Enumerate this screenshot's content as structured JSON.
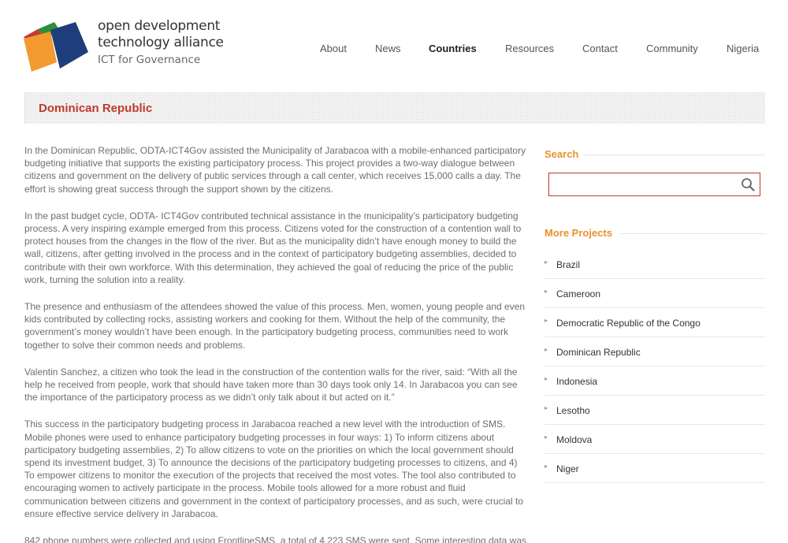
{
  "logo": {
    "line1": "open development",
    "line2": "technology alliance",
    "line3": "ICT for Governance",
    "colors": {
      "red": "#c43a2c",
      "green": "#2e8f3a",
      "orange": "#f29a2e",
      "blue": "#1e3e7b"
    }
  },
  "nav": {
    "items": [
      {
        "label": "About"
      },
      {
        "label": "News"
      },
      {
        "label": "Countries",
        "active": true
      },
      {
        "label": "Resources"
      },
      {
        "label": "Contact"
      },
      {
        "label": "Community"
      },
      {
        "label": "Nigeria"
      }
    ]
  },
  "page": {
    "title": "Dominican Republic"
  },
  "content": {
    "paragraphs": [
      "In the Dominican Republic, ODTA-ICT4Gov assisted the Municipality of Jarabacoa with a mobile-enhanced participatory budgeting initiative that supports the existing participatory process. This project provides a two-way dialogue between citizens and government on the delivery of public services through a call center, which receives 15,000 calls a day. The effort is showing great success through the support shown by the citizens.",
      "In the past budget cycle, ODTA- ICT4Gov contributed technical assistance in the municipality’s participatory budgeting process. A very inspiring example emerged from this process. Citizens voted for the construction of a contention wall to protect houses from the changes in the flow of the river. But as the municipality didn’t have enough money to build the wall, citizens, after getting involved in the process and in the context of participatory budgeting assemblies, decided to contribute with their own workforce. With this determination, they achieved the goal of reducing the price of the public work, turning the solution into a reality.",
      "The presence and enthusiasm of the attendees showed the value of this process. Men, women, young people and even kids contributed by collecting rocks, assisting workers and cooking for them. Without the help of the community, the government’s money wouldn’t have been enough. In the participatory budgeting process, communities need to work together to solve their common needs and problems.",
      "Valentin Sanchez, a citizen who took the lead in the construction of the contention walls for the river, said: “With all the help he received from people, work that should have taken more than 30 days took only 14. In Jarabacoa you can see the importance of the participatory process as we didn’t only talk about it but acted on it.”",
      "This success in the participatory budgeting process in Jarabacoa reached a new level with the introduction of SMS. Mobile phones were used to enhance participatory budgeting processes in four ways: 1) To inform citizens about participatory budgeting assemblies, 2) To allow citizens to vote on the priorities on which the local government should spend its investment budget, 3) To announce the decisions of the participatory budgeting processes to citizens, and 4) To empower citizens to monitor the execution of the projects that received the most votes. The tool also contributed to encouraging women to actively participate in the process. Mobile tools allowed for a more robust and fluid communication between citizens and government in the context of participatory processes, and as such, were crucial to ensure effective service delivery in Jarabacoa.",
      "842 phone numbers were collected and using FrontlineSMS, a total of 4,223 SMS were sent. Some interesting data was"
    ]
  },
  "sidebar": {
    "search_heading": "Search",
    "search_value": "",
    "projects_heading": "More Projects",
    "projects": [
      {
        "label": "Brazil"
      },
      {
        "label": "Cameroon"
      },
      {
        "label": "Democratic Republic of the Congo"
      },
      {
        "label": "Dominican Republic"
      },
      {
        "label": "Indonesia"
      },
      {
        "label": "Lesotho"
      },
      {
        "label": "Moldova"
      },
      {
        "label": "Niger"
      }
    ]
  },
  "icons": {
    "search": "search-icon",
    "arrow": "arrow-right-icon"
  }
}
